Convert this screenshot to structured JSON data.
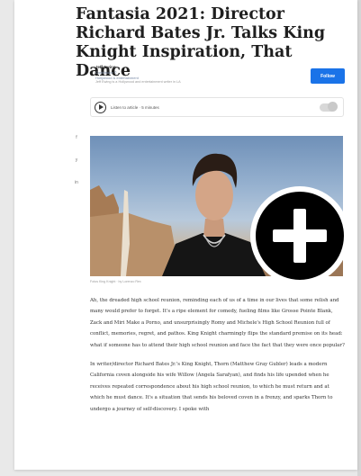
{
  "article": {
    "title": "Fantasia 2021: Director Richard Bates Jr. Talks King Knight Inspiration, That Dance",
    "author": "Jeff Ewing",
    "author_role": "Contributor ©",
    "author_role_2": "Hollywood & entertainment",
    "author_meta": "Jeff Ewing is a Hollywood and entertainment writer in LA",
    "follow_label": "Follow",
    "listen_label": "Listen to article",
    "listen_duration": "5 minutes",
    "image_caption": "Fotos King Knight · by Lorenzo Rex",
    "paragraphs": [
      "Ah, the dreaded high school reunion, reminding each of us of a time in our lives that some relish and many would prefer to forget. It's a ripe element for comedy, fueling films like Grosse Pointe Blank, Zack and Miri Make a Porno, and unsurprisingly Romy and Michele's High School Reunion full of conflict, memories, regret, and pathos. King Knight charmingly flips the standard premise on its head: what if someone has to attend their high school reunion and face the fact that they were once popular?",
      "In writer/director Richard Bates Jr.'s King Knight, Thorn (Matthew Gray Gubler) leads a modern California coven alongside his wife Willow (Angela Sarafyan), and finds his life upended when he receives repeated correspondence about his high school reunion, to which he must return and at which he must dance. It's a situation that sends his beloved coven in a frenzy, and sparks Thorn to undergo a journey of self-discovery. I spoke with"
    ]
  },
  "share_rail": [
    "f",
    "y",
    "in"
  ],
  "colors": {
    "follow_button": "#1a73e8",
    "badge_background": "#000000",
    "badge_icon": "#ffffff"
  },
  "icons": {
    "play": "play-icon",
    "toggle": "toggle-icon",
    "add": "plus-icon"
  }
}
